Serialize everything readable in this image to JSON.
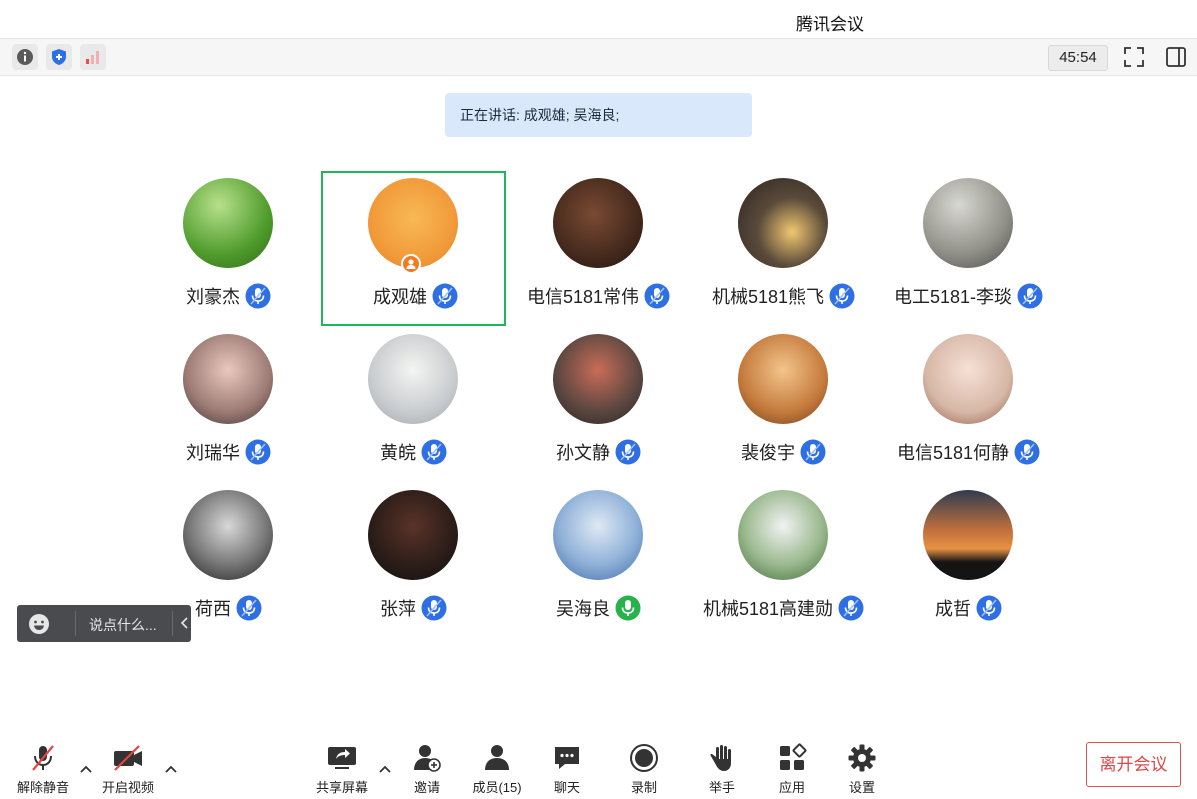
{
  "window": {
    "title": "腾讯会议"
  },
  "infobar": {
    "timer": "45:54"
  },
  "speaking": {
    "text": "正在讲话: 成观雄; 吴海良;"
  },
  "participants": [
    {
      "name": "刘豪杰"
    },
    {
      "name": "成观雄",
      "active": true,
      "host": true
    },
    {
      "name": "电信5181常伟"
    },
    {
      "name": "机械5181熊飞"
    },
    {
      "name": "电工5181-李琰"
    },
    {
      "name": "刘瑞华"
    },
    {
      "name": "黄皖"
    },
    {
      "name": "孙文静"
    },
    {
      "name": "裴俊宇"
    },
    {
      "name": "电信5181何静"
    },
    {
      "name": "荷西"
    },
    {
      "name": "张萍"
    },
    {
      "name": "吴海良",
      "speaking_mic": true
    },
    {
      "name": "机械5181高建勋"
    },
    {
      "name": "成哲"
    }
  ],
  "chat": {
    "placeholder": "说点什么..."
  },
  "toolbar": {
    "unmute": "解除静音",
    "video": "开启视频",
    "share": "共享屏幕",
    "invite": "邀请",
    "members": "成员(15)",
    "chat": "聊天",
    "record": "录制",
    "raise_hand": "举手",
    "apps": "应用",
    "settings": "设置",
    "leave": "离开会议"
  },
  "colors": {
    "accent_blue": "#2f6fe4",
    "active_green": "#21b65a",
    "leave_red": "#e04545",
    "mic_green": "#28b24b"
  }
}
